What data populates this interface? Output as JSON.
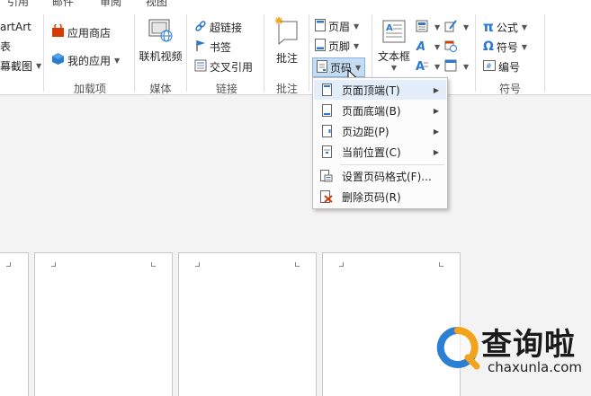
{
  "tabs": [
    "引用",
    "邮件",
    "审阅",
    "视图"
  ],
  "illustrations": {
    "smartart": "artArt",
    "chart": "表",
    "screenshot": "幕截图"
  },
  "addins": {
    "store": "应用商店",
    "myapps": "我的应用",
    "label": "加载项"
  },
  "media": {
    "online_video": "联机视频",
    "label": "媒体"
  },
  "links": {
    "hyperlink": "超链接",
    "bookmark": "书签",
    "crossref": "交叉引用",
    "label": "链接"
  },
  "comments": {
    "comment": "批注",
    "label": "批注"
  },
  "header_footer": {
    "header": "页眉",
    "footer": "页脚",
    "page_number": "页码"
  },
  "text": {
    "textbox": "文本框"
  },
  "symbols": {
    "equation": "公式",
    "symbol": "符号",
    "numbering": "编号",
    "label": "符号"
  },
  "menu": {
    "items": [
      {
        "label": "页面顶端(T)",
        "submenu": true
      },
      {
        "label": "页面底端(B)",
        "submenu": true
      },
      {
        "label": "页边距(P)",
        "submenu": true
      },
      {
        "label": "当前位置(C)",
        "submenu": true
      },
      {
        "label": "设置页码格式(F)...",
        "submenu": false
      },
      {
        "label": "删除页码(R)",
        "submenu": false
      }
    ]
  },
  "watermark": {
    "title": "查询啦",
    "url": "chaxunla.com"
  },
  "colors": {
    "accent_blue": "#2b79d0",
    "highlight": "#c5dcf3",
    "watermark_orange": "#f3a31b",
    "watermark_blue": "#2d7fd3"
  }
}
